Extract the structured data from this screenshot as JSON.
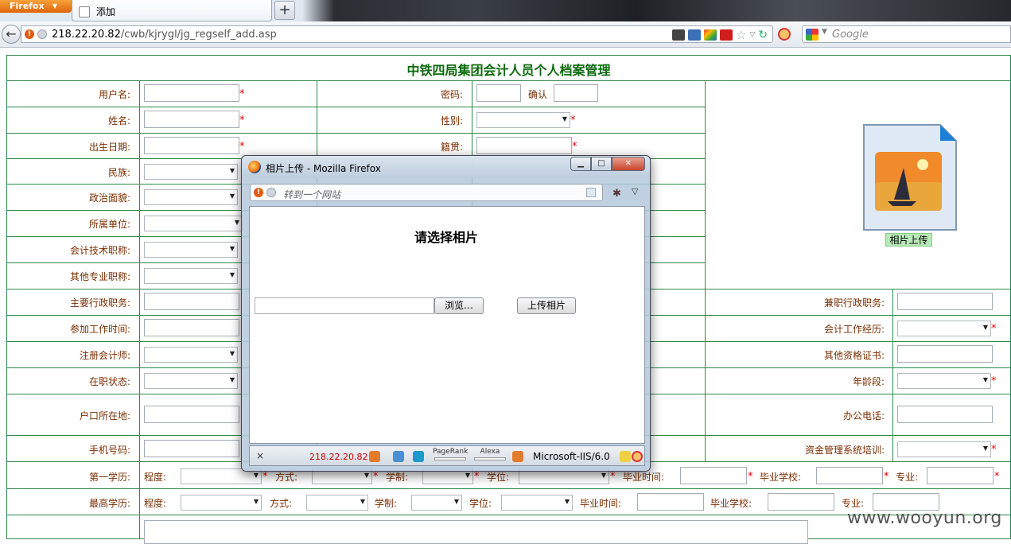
{
  "browser": {
    "menu_button": "Firefox",
    "tab_title": "添加",
    "new_tab": "+",
    "url_host": "218.22.20.82",
    "url_path": "/cwb/kjrygl/jg_regself_add.asp",
    "search_engine": "Google"
  },
  "form": {
    "title": "中铁四局集团会计人员个人档案管理",
    "required_mark": "*",
    "labels": {
      "username": "用户名:",
      "password": "密码:",
      "confirm": "确认",
      "name": "姓名:",
      "gender": "性别:",
      "birth": "出生日期:",
      "native": "籍贯:",
      "ethnic": "民族:",
      "political": "政治面貌:",
      "unit": "所属单位:",
      "tech_title": "会计技术职称:",
      "other_title": "其他专业职称:",
      "admin_post": "主要行政职务:",
      "part_admin": "兼职行政职务:",
      "work_start": "参加工作时间:",
      "acc_exp": "会计工作经历:",
      "cpa": "注册会计师:",
      "other_cert": "其他资格证书:",
      "status": "在职状态:",
      "age_group": "年龄段:",
      "hukou": "户口所在地:",
      "office_phone": "办公电话:",
      "mobile": "手机号码:",
      "fund_training": "资金管理系统培训:",
      "first_edu": "第一学历:",
      "highest_edu": "最高学历:"
    },
    "edu_fields": {
      "level": "程度:",
      "mode": "方式:",
      "length": "学制:",
      "degree": "学位:",
      "grad_time": "毕业时间:",
      "school": "毕业学校:",
      "major": "专业:"
    },
    "photo_caption": "相片上传"
  },
  "popup": {
    "window_title": "相片上传 - Mozilla Firefox",
    "url_placeholder": "转到一个网站",
    "heading": "请选择相片",
    "browse_button": "浏览…",
    "upload_button": "上传相片",
    "status_close": "×",
    "status_host": "218.22.20.82",
    "pagerank": "PageRank",
    "alexa": "Alexa",
    "server": "Microsoft-IIS/6.0"
  },
  "watermark": "www.wooyun.org",
  "colors": {
    "border": "#2f8a4a",
    "title": "#0b6a0b",
    "label": "#7a2e00",
    "required": "#e00000"
  }
}
